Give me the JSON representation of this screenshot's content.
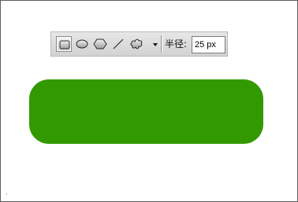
{
  "toolbar": {
    "tools": [
      {
        "name": "rounded-rectangle-tool",
        "icon": "rounded-rectangle-icon",
        "selected": true
      },
      {
        "name": "ellipse-tool",
        "icon": "ellipse-icon",
        "selected": false
      },
      {
        "name": "polygon-tool",
        "icon": "hexagon-icon",
        "selected": false
      },
      {
        "name": "line-tool",
        "icon": "line-icon",
        "selected": false
      },
      {
        "name": "custom-shape-tool",
        "icon": "custom-shape-icon",
        "selected": false
      }
    ],
    "dropdown_icon": "chevron-down-icon",
    "radius_label": "半径:",
    "radius_value": "25 px"
  },
  "canvas": {
    "shape_color": "#339900",
    "shape_type": "rounded-rectangle"
  }
}
